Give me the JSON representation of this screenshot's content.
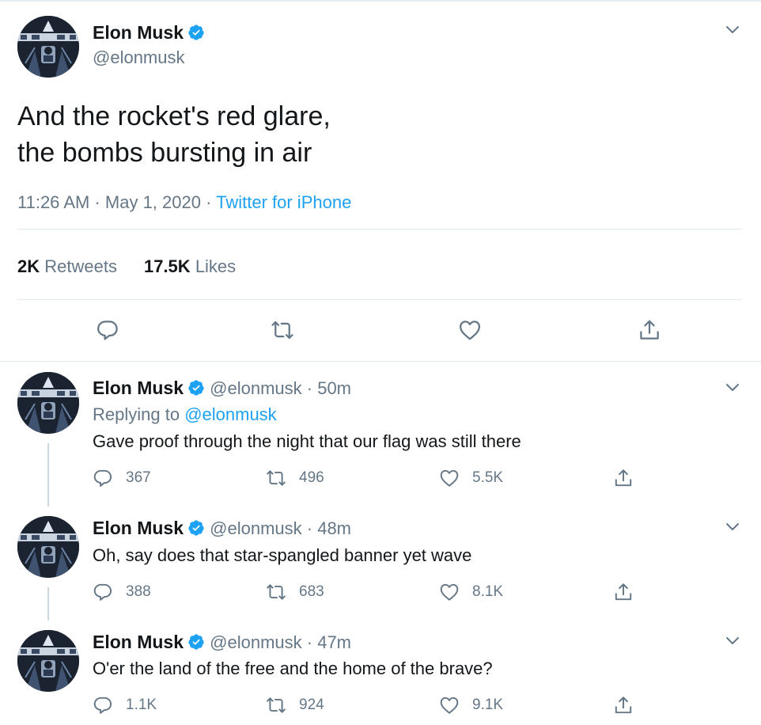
{
  "main": {
    "name": "Elon Musk",
    "handle": "@elonmusk",
    "text": "And the rocket's red glare,\nthe bombs bursting in air",
    "time": "11:26 AM",
    "sep1": " · ",
    "date": "May 1, 2020",
    "sep2": " · ",
    "source": "Twitter for iPhone",
    "retweets_count": "2K",
    "retweets_label": "Retweets",
    "likes_count": "17.5K",
    "likes_label": "Likes"
  },
  "replies": [
    {
      "name": "Elon Musk",
      "handle": "@elonmusk",
      "time": "· 50m",
      "replying_prefix": "Replying to ",
      "replying_to": "@elonmusk",
      "text": "Gave proof through the night that our flag was still there",
      "reply_count": "367",
      "retweet_count": "496",
      "like_count": "5.5K"
    },
    {
      "name": "Elon Musk",
      "handle": "@elonmusk",
      "time": "· 48m",
      "text": "Oh, say does that star-spangled banner yet wave",
      "reply_count": "388",
      "retweet_count": "683",
      "like_count": "8.1K"
    },
    {
      "name": "Elon Musk",
      "handle": "@elonmusk",
      "time": "· 47m",
      "text": "O'er the land of the free and the home of the brave?",
      "reply_count": "1.1K",
      "retweet_count": "924",
      "like_count": "9.1K"
    }
  ],
  "colors": {
    "accent": "#1da1f2",
    "secondary_text": "#657786",
    "primary_text": "#14171a",
    "divider": "#e1e8ed"
  },
  "icons": [
    "verified-badge-icon",
    "chevron-down-icon",
    "reply-icon",
    "retweet-icon",
    "like-icon",
    "share-icon"
  ]
}
